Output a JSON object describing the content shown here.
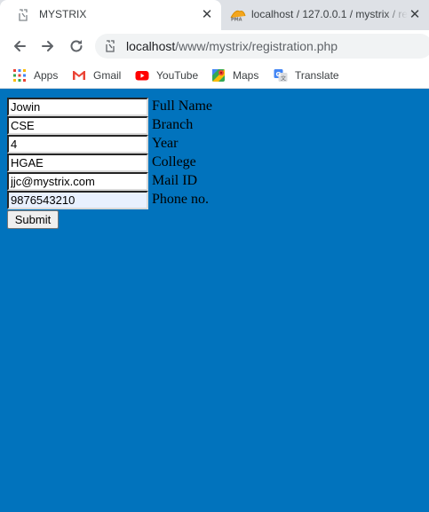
{
  "tabs": [
    {
      "title": "MYSTRIX",
      "close": "✕",
      "favicon": "broken-page-icon"
    },
    {
      "title": "localhost / 127.0.0.1 / mystrix / re",
      "close": "✕",
      "favicon": "phpmyadmin-icon"
    }
  ],
  "address": {
    "host": "localhost",
    "path": "/www/mystrix/registration.php"
  },
  "bookmarks": [
    {
      "label": "Apps",
      "icon": "apps-grid-icon"
    },
    {
      "label": "Gmail",
      "icon": "gmail-icon"
    },
    {
      "label": "YouTube",
      "icon": "youtube-icon"
    },
    {
      "label": "Maps",
      "icon": "maps-icon"
    },
    {
      "label": "Translate",
      "icon": "translate-icon"
    }
  ],
  "form": {
    "fields": [
      {
        "value": "Jowin",
        "label": "Full Name"
      },
      {
        "value": "CSE",
        "label": "Branch"
      },
      {
        "value": "4",
        "label": "Year"
      },
      {
        "value": "HGAE",
        "label": "College"
      },
      {
        "value": "jjc@mystrix.com",
        "label": "Mail ID"
      },
      {
        "value": "9876543210",
        "label": "Phone no."
      }
    ],
    "submit_label": "Submit"
  },
  "colors": {
    "page_background": "#0173bd",
    "tabstrip": "#dee1e6",
    "autofill": "#e8f0fe"
  }
}
